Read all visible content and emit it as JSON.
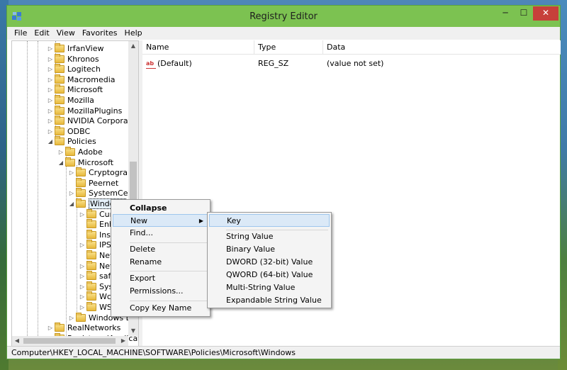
{
  "window": {
    "title": "Registry Editor",
    "min": "─",
    "max": "☐",
    "close": "✕"
  },
  "menu": [
    "File",
    "Edit",
    "View",
    "Favorites",
    "Help"
  ],
  "tree": {
    "rows": [
      {
        "label": "IrfanView",
        "indent": 1,
        "exp": "▷"
      },
      {
        "label": "Khronos",
        "indent": 1,
        "exp": "▷"
      },
      {
        "label": "Logitech",
        "indent": 1,
        "exp": "▷"
      },
      {
        "label": "Macromedia",
        "indent": 1,
        "exp": "▷"
      },
      {
        "label": "Microsoft",
        "indent": 1,
        "exp": "▷"
      },
      {
        "label": "Mozilla",
        "indent": 1,
        "exp": "▷"
      },
      {
        "label": "MozillaPlugins",
        "indent": 1,
        "exp": "▷"
      },
      {
        "label": "NVIDIA Corporation",
        "indent": 1,
        "exp": "▷"
      },
      {
        "label": "ODBC",
        "indent": 1,
        "exp": "▷"
      },
      {
        "label": "Policies",
        "indent": 1,
        "exp": "◢"
      },
      {
        "label": "Adobe",
        "indent": 2,
        "exp": "▷"
      },
      {
        "label": "Microsoft",
        "indent": 2,
        "exp": "◢"
      },
      {
        "label": "Cryptography",
        "indent": 3,
        "exp": "▷"
      },
      {
        "label": "Peernet",
        "indent": 3,
        "exp": ""
      },
      {
        "label": "SystemCertificates",
        "indent": 3,
        "exp": "▷"
      },
      {
        "label": "Windows",
        "indent": 3,
        "exp": "◢",
        "selected": true
      },
      {
        "label": "CurrentVersion",
        "indent": 4,
        "exp": "▷"
      },
      {
        "label": "EnhancedStorageDevices",
        "indent": 4,
        "exp": ""
      },
      {
        "label": "Installer",
        "indent": 4,
        "exp": ""
      },
      {
        "label": "IPSec",
        "indent": 4,
        "exp": "▷"
      },
      {
        "label": "Network Connections",
        "indent": 4,
        "exp": ""
      },
      {
        "label": "NetworkProvider",
        "indent": 4,
        "exp": "▷"
      },
      {
        "label": "safer",
        "indent": 4,
        "exp": "▷"
      },
      {
        "label": "System",
        "indent": 4,
        "exp": "▷"
      },
      {
        "label": "WcmSvc",
        "indent": 4,
        "exp": "▷"
      },
      {
        "label": "WSDAPI",
        "indent": 4,
        "exp": "▷"
      },
      {
        "label": "Windows Defender",
        "indent": 3,
        "exp": "▷"
      },
      {
        "label": "RealNetworks",
        "indent": 1,
        "exp": "▷"
      },
      {
        "label": "RegisteredApplications",
        "indent": 1,
        "exp": ""
      }
    ]
  },
  "list": {
    "columns": [
      "Name",
      "Type",
      "Data"
    ],
    "rows": [
      {
        "name": "(Default)",
        "type": "REG_SZ",
        "data": "(value not set)"
      }
    ]
  },
  "status": "Computer\\HKEY_LOCAL_MACHINE\\SOFTWARE\\Policies\\Microsoft\\Windows",
  "context_menu": {
    "items": [
      "Collapse",
      "New",
      "Find...",
      "Delete",
      "Rename",
      "Export",
      "Permissions...",
      "Copy Key Name"
    ]
  },
  "submenu": {
    "items": [
      "Key",
      "String Value",
      "Binary Value",
      "DWORD (32-bit) Value",
      "QWORD (64-bit) Value",
      "Multi-String Value",
      "Expandable String Value"
    ]
  }
}
